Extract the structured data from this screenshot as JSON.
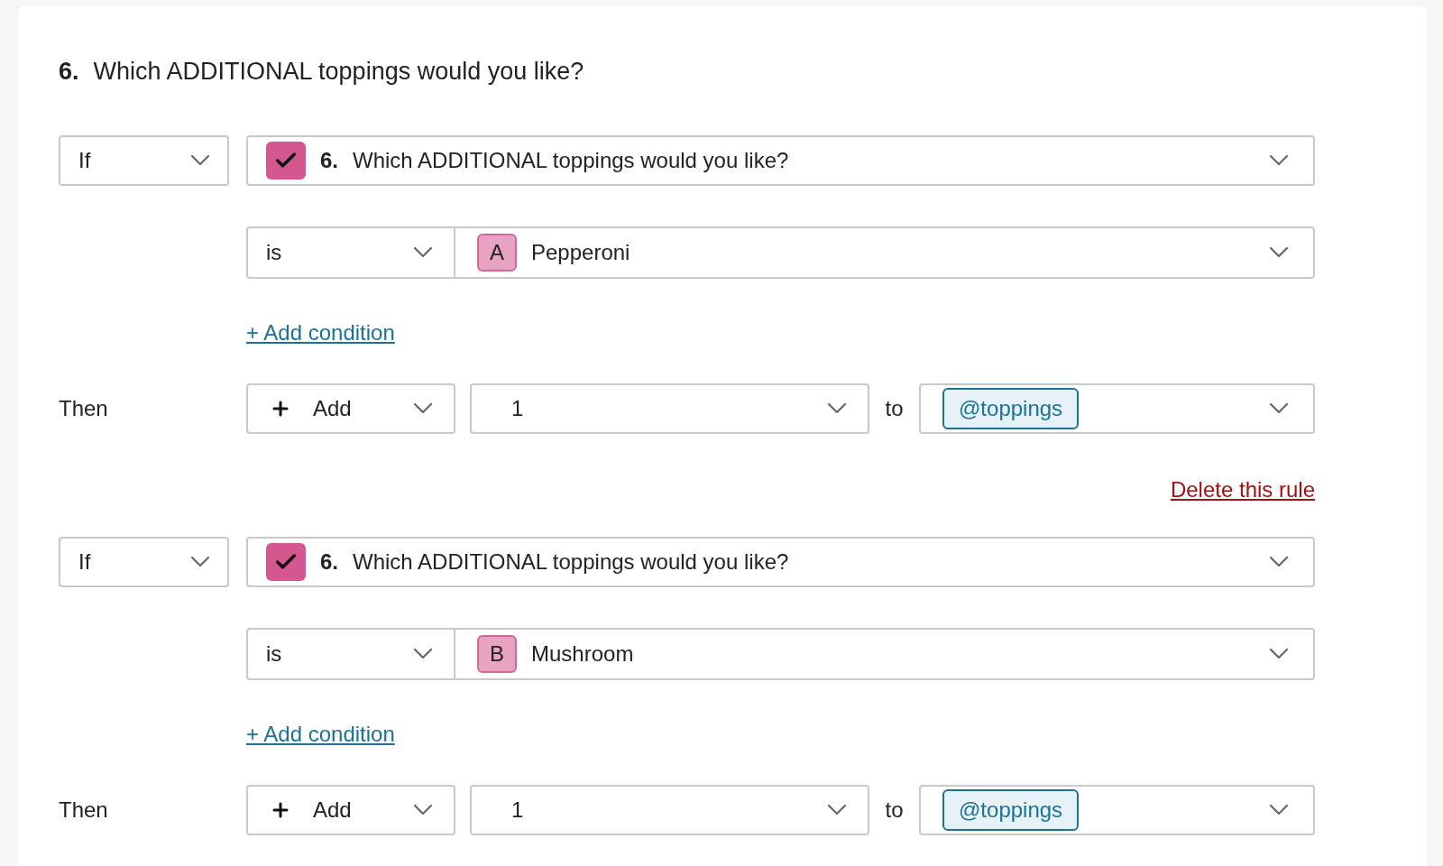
{
  "question": {
    "number": "6.",
    "text": "Which ADDITIONAL toppings would you like?"
  },
  "rules": [
    {
      "condition": "If",
      "question": {
        "number": "6.",
        "text": "Which ADDITIONAL toppings would you like?"
      },
      "operator": "is",
      "answer": {
        "letter": "A",
        "label": "Pepperoni"
      },
      "add_condition": "+ Add condition",
      "then_label": "Then",
      "action": "Add",
      "value": "1",
      "to": "to",
      "variable": "@toppings",
      "delete": "Delete this rule"
    },
    {
      "condition": "If",
      "question": {
        "number": "6.",
        "text": "Which ADDITIONAL toppings would you like?"
      },
      "operator": "is",
      "answer": {
        "letter": "B",
        "label": "Mushroom"
      },
      "add_condition": "+ Add condition",
      "then_label": "Then",
      "action": "Add",
      "value": "1",
      "to": "to",
      "variable": "@toppings"
    }
  ]
}
